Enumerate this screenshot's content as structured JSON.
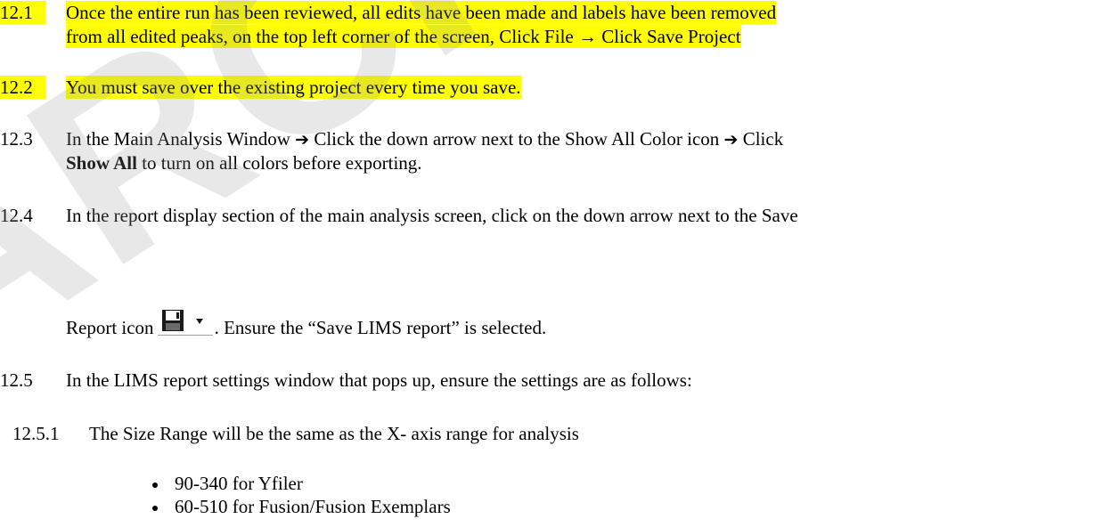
{
  "colors": {
    "highlight": "#ffff00",
    "watermark": "#969696"
  },
  "items": {
    "s12_1": {
      "num": "12.1",
      "line1": "Once the entire run has been reviewed, all edits have been made and labels have been removed",
      "line2": "from all edited peaks, on the top left corner of the screen, Click File → Click Save Project"
    },
    "s12_2": {
      "num": "12.2",
      "text": "You must save over the existing project every time you save."
    },
    "s12_3": {
      "num": "12.3",
      "line1_pre": "In the Main Analysis Window",
      "line1_mid": "Click the down arrow next to the Show All Color icon",
      "line1_post": "Click",
      "bold": "Show All",
      "line2_rest": " to turn on all colors before exporting."
    },
    "s12_4": {
      "num": "12.4",
      "line1": "In the report display section of the main analysis screen, click on the down arrow next to the Save",
      "line2_pre": "Report icon",
      "line2_post": ". Ensure the “Save LIMS report” is selected."
    },
    "s12_5": {
      "num": "12.5",
      "text": "In the LIMS report settings window that pops up, ensure the settings are as follows:"
    },
    "s12_5_1": {
      "num": "12.5.1",
      "text": "The Size Range will be the same as the X- axis range for analysis",
      "bullets": [
        "90-340 for Yfiler",
        "60-510 for Fusion/Fusion Exemplars"
      ]
    }
  },
  "icons": {
    "save": "floppy-disk-icon",
    "dropdown": "chevron-down-icon",
    "arrow": "arrow-right-icon"
  },
  "watermark": "ARCHIVED"
}
